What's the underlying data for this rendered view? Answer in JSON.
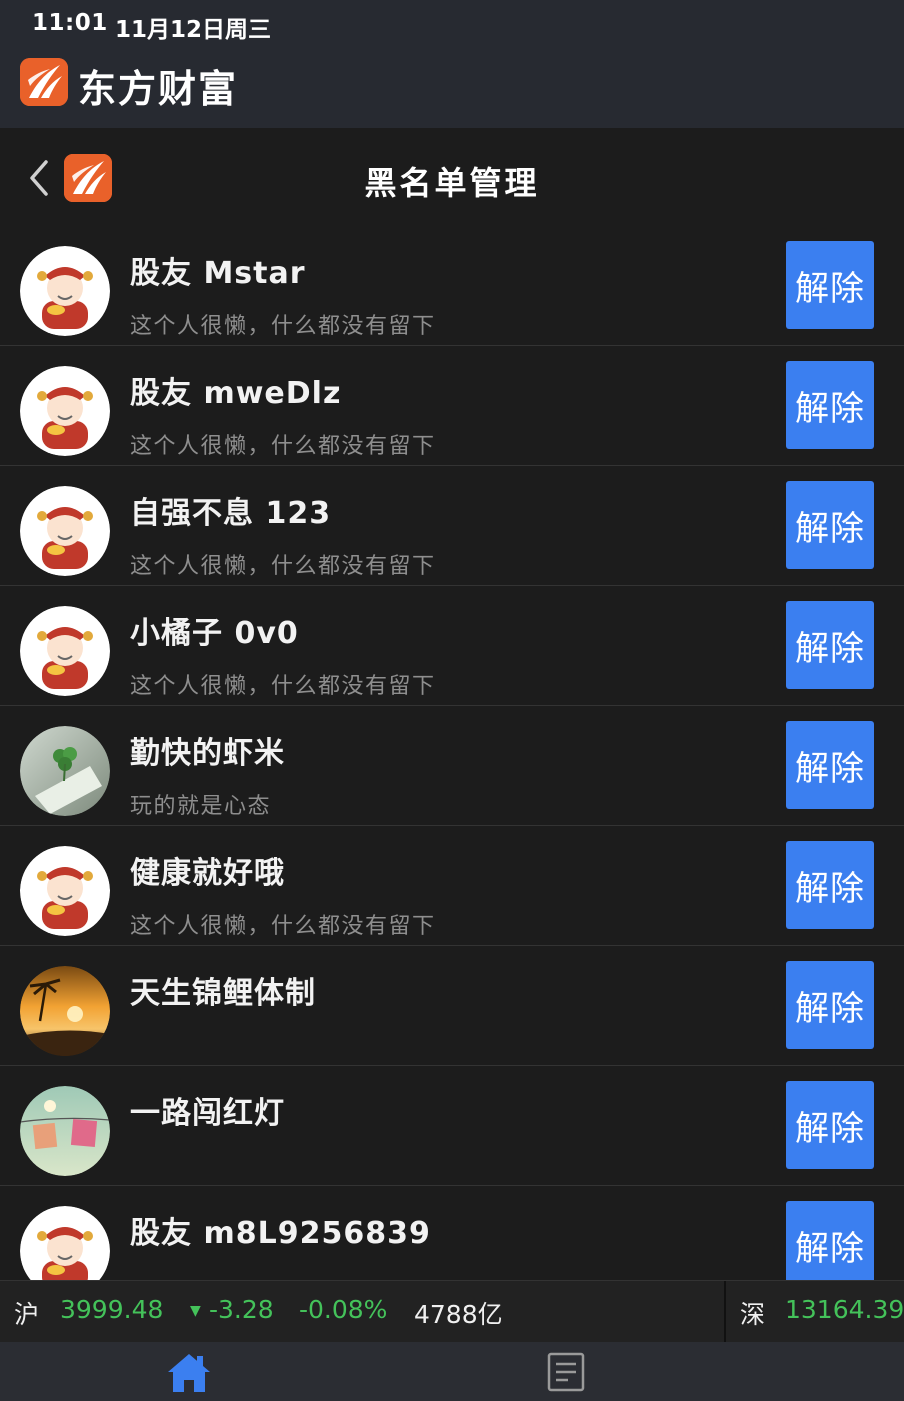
{
  "status_bar": {
    "time": "11:01",
    "date": "11月12日周三"
  },
  "brand": {
    "name": "东方财富",
    "icon": "eastmoney-logo-icon"
  },
  "nav": {
    "title": "黑名单管理",
    "back_icon": "chevron-left-icon"
  },
  "colors": {
    "accent_button": "#3b7ff0",
    "brand_orange": "#e9612a",
    "ticker_green": "#44c25a"
  },
  "blacklist": [
    {
      "name": "股友 Mstar",
      "signature": "这个人很懒，什么都没有留下",
      "avatar": "caishen-avatar-icon",
      "action": "解除"
    },
    {
      "name": "股友 mweDlz",
      "signature": "这个人很懒，什么都没有留下",
      "avatar": "caishen-avatar-icon",
      "action": "解除"
    },
    {
      "name": "自强不息 123",
      "signature": "这个人很懒，什么都没有留下",
      "avatar": "caishen-avatar-icon",
      "action": "解除"
    },
    {
      "name": "小橘子 0v0",
      "signature": "这个人很懒，什么都没有留下",
      "avatar": "caishen-avatar-icon",
      "action": "解除"
    },
    {
      "name": "勤快的虾米",
      "signature": "玩的就是心态",
      "avatar": "clover-photo-avatar",
      "action": "解除"
    },
    {
      "name": "健康就好哦",
      "signature": "这个人很懒，什么都没有留下",
      "avatar": "caishen-avatar-icon",
      "action": "解除"
    },
    {
      "name": "天生锦鲤体制",
      "signature": "",
      "avatar": "sunset-photo-avatar",
      "action": "解除"
    },
    {
      "name": "一路闯红灯",
      "signature": "",
      "avatar": "clothesline-photo-avatar",
      "action": "解除"
    },
    {
      "name": "股友 m8L9256839",
      "signature": "",
      "avatar": "caishen-avatar-icon",
      "action": "解除"
    }
  ],
  "ticker": {
    "sh_label": "沪",
    "sh_index": "3999.48",
    "sh_arrow": "▼",
    "sh_change": "-3.28",
    "sh_pct": "-0.08%",
    "sh_volume": "4788亿",
    "sz_label": "深",
    "sz_index": "13164.39"
  },
  "tabbar": {
    "home_icon": "home-icon",
    "news_icon": "document-icon"
  }
}
